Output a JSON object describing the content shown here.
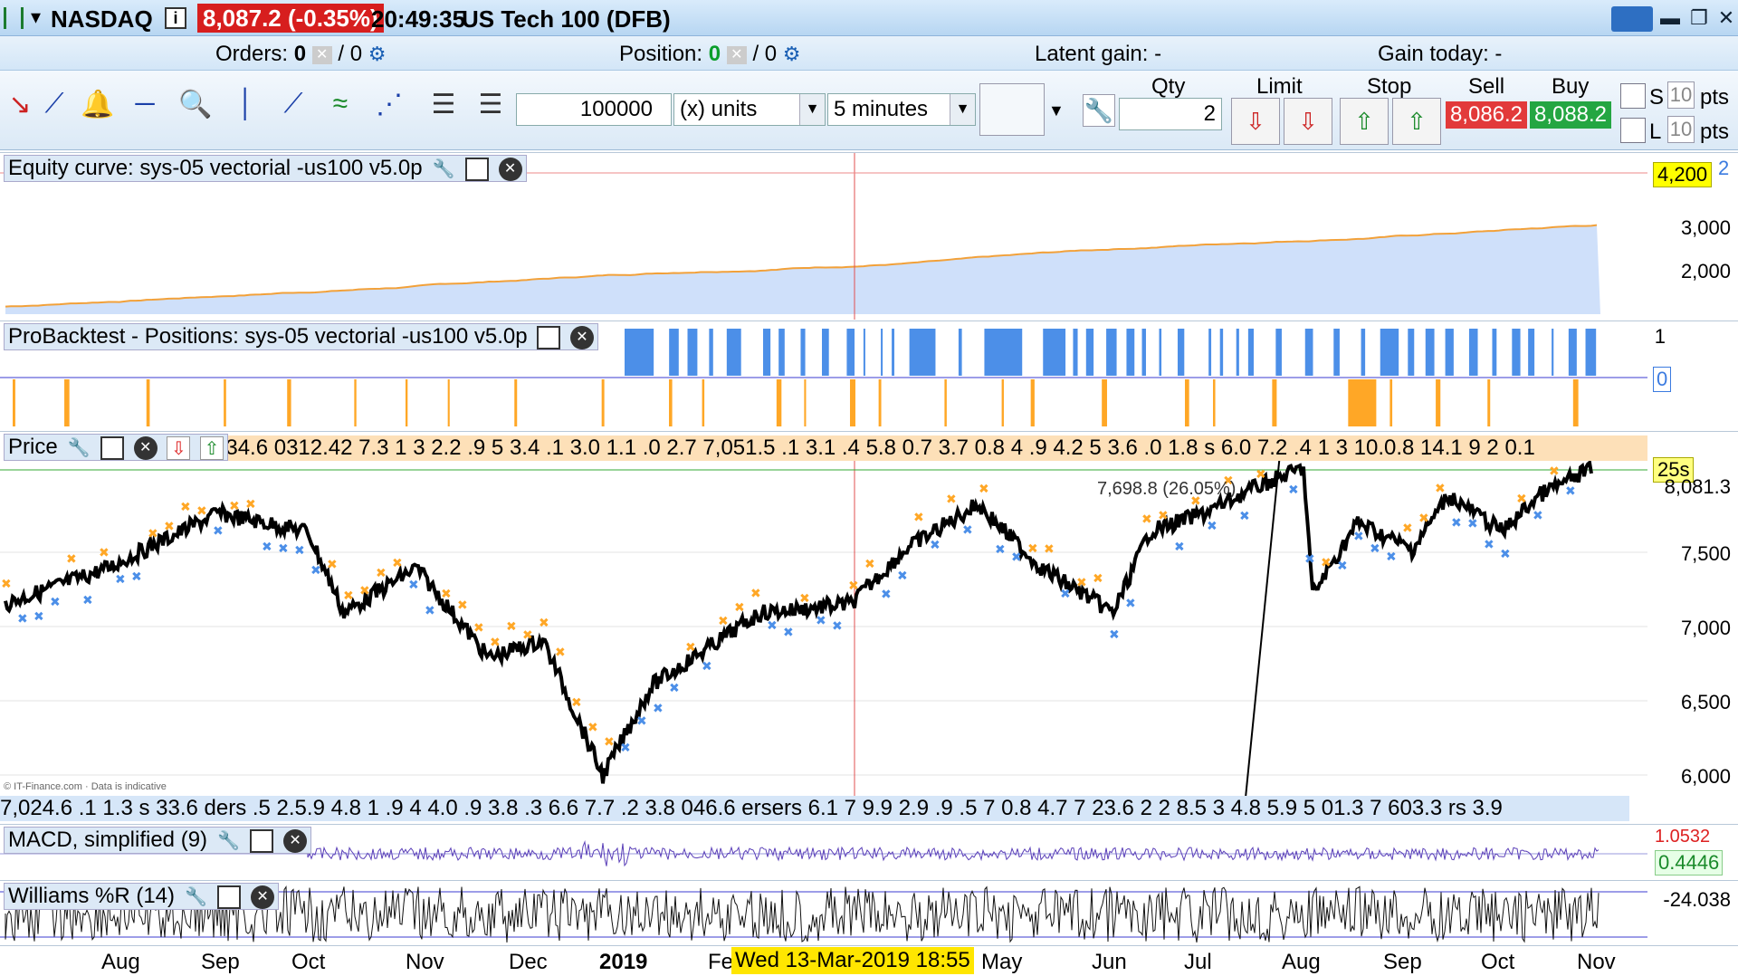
{
  "window": {
    "symbol": "NASDAQ",
    "price": "8,087.2 (-0.35%)",
    "time": "20:49:35",
    "instrument": "US Tech 100 (DFB)"
  },
  "orders_bar": {
    "orders_label": "Orders:",
    "orders_value": "0",
    "orders_total": "/ 0",
    "position_label": "Position:",
    "position_value": "0",
    "position_total": "/ 0",
    "latent_gain": "Latent gain: -",
    "gain_today": "Gain today: -"
  },
  "toolbar": {
    "units_value": "100000",
    "units_label": "(x) units",
    "timeframe": "5 minutes",
    "qty_label": "Qty",
    "qty_value": "2",
    "limit_label": "Limit",
    "stop_label": "Stop",
    "sell_label": "Sell",
    "buy_label": "Buy",
    "sell_price": "8,086.2",
    "buy_price": "8,088.2",
    "s_label": "S",
    "l_label": "L",
    "s_pts": "10",
    "l_pts": "10",
    "pts_label": "pts",
    "sell_color": "#e23a3a",
    "buy_color": "#24a642"
  },
  "panels": {
    "equity": {
      "title": "Equity curve: sys-05 vectorial -us100 v5.0p",
      "current_value": "4,200",
      "right_value_2": "2",
      "axis": [
        "3,000",
        "2,000"
      ]
    },
    "positions": {
      "title": "ProBacktest - Positions: sys-05 vectorial -us100 v5.0p",
      "axis_top": "1",
      "axis_zero": "0"
    },
    "price": {
      "title": "Price",
      "overlay_text": "634.6 0312.42 7.3 1 3 2.2 .9 5 3.4 .1 3.0 1.1 .0 2.7 7,051.5 .1 3.1 .4 5.8 0.7 3.7 0.8 4 .9 4.2 5 3.6 .0 1.8 s 6.0 7.2 .4 1 3 10.0.8 14.1 9 2 0.1",
      "countdown": "25s",
      "last_price": "8,081.3",
      "axis": [
        "7,500",
        "7,000",
        "6,500",
        "6,000"
      ],
      "bottom_overlay": "7,024.6 .1 1.3 s 33.6 ders .5 2.5.9 4.8 1 .9 4 4.0 .9 3.8 .3 6.6 7.7 .2 3.8 046.6 ersers 6.1 7 9.9 2.9 .9 .5 7 0.8 4.7 7 23.6 2 2 8.5 3 4.8 5.9 5 01.3 7 603.3 rs 3.9",
      "watermark": "© IT-Finance.com · Data is indicative",
      "trade_note": "7,698.8 (26.05%)"
    },
    "macd": {
      "title": "MACD, simplified (9)",
      "value": "0.4446",
      "value_top": "1.0532"
    },
    "williams": {
      "title": "Williams %R (14)",
      "value": "-24.038"
    }
  },
  "time_axis": {
    "months": [
      "Aug",
      "Sep",
      "Oct",
      "Nov",
      "Dec",
      "2019",
      "Fe",
      "May",
      "Jun",
      "Jul",
      "Aug",
      "Sep",
      "Oct",
      "Nov"
    ],
    "cursor_date": "Wed 13-Mar-2019 18:55"
  },
  "colors": {
    "equity_fill": "#cfe0fa",
    "equity_line": "#f2a13a",
    "long_bar": "#4c8fe8",
    "short_bar": "#ffa726",
    "macd_line": "#5a3fb8",
    "cursor_line": "#e05050"
  }
}
